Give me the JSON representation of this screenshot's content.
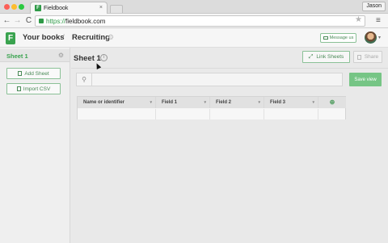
{
  "browser": {
    "tab_title": "Fieldbook",
    "tab_favicon": "F",
    "tab_close": "×",
    "user": "Jason",
    "url_scheme": "https://",
    "url_host": "fieldbook.com",
    "back_glyph": "←",
    "forward_glyph": "→",
    "reload_glyph": "C",
    "star_glyph": "★",
    "menu_glyph": "≡"
  },
  "header": {
    "logo": "F",
    "your_books": "Your books",
    "separator": "/",
    "book_name": "Recruiting",
    "book_gear": "⚙",
    "message_us": "Message us",
    "avatar_caret": "▾"
  },
  "sidebar": {
    "sheet_label": "Sheet 1",
    "sheet_gear": "⚙",
    "add_sheet": "Add Sheet",
    "import_csv": "Import CSV"
  },
  "main": {
    "sheet_title": "Sheet 1",
    "info_glyph": "i",
    "link_sheets": "Link Sheets",
    "link_glyph": "⤢",
    "share": "Share",
    "search_glyph": "⚲",
    "search_value": "",
    "save_view": "Save view",
    "columns": [
      "Name or identifier",
      "Field 1",
      "Field 2",
      "Field 3"
    ],
    "column_caret": "▾",
    "add_column_glyph": "⊕"
  },
  "colors": {
    "brand_green": "#3aa34f",
    "button_green": "#76c585"
  }
}
